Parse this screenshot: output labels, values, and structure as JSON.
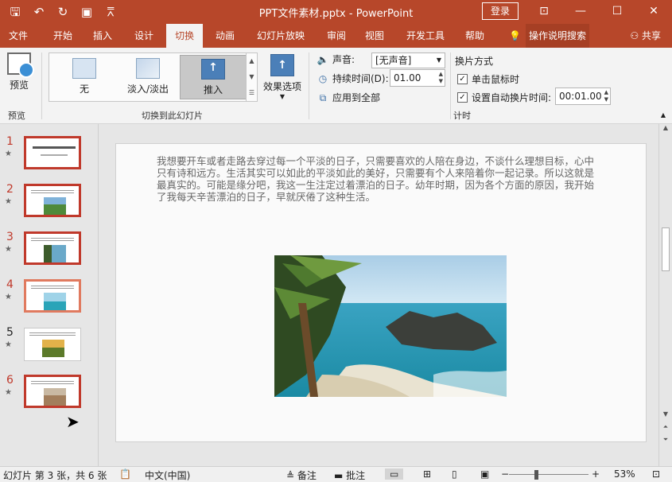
{
  "window": {
    "title": "PPT文件素材.pptx  -  PowerPoint",
    "login_label": "登录",
    "controls": [
      "ribbon-display-icon",
      "minimize-icon",
      "maximize-icon",
      "close-icon"
    ]
  },
  "qat": [
    "save-icon",
    "undo-icon",
    "redo-icon",
    "start-from-beginning-icon",
    "customize-icon"
  ],
  "tabs": [
    {
      "label": "文件"
    },
    {
      "label": "开始"
    },
    {
      "label": "插入"
    },
    {
      "label": "设计"
    },
    {
      "label": "切换",
      "active": true
    },
    {
      "label": "动画"
    },
    {
      "label": "幻灯片放映"
    },
    {
      "label": "审阅"
    },
    {
      "label": "视图"
    },
    {
      "label": "开发工具"
    },
    {
      "label": "帮助"
    }
  ],
  "tellme": {
    "text": "操作说明搜索"
  },
  "share": {
    "label": "共享"
  },
  "ribbon": {
    "preview": {
      "button": "预览",
      "group": "预览"
    },
    "transitions": {
      "items": [
        "无",
        "淡入/淡出",
        "推入"
      ],
      "selected": "推入",
      "effect_options": "效果选项",
      "group": "切换到此幻灯片"
    },
    "timing": {
      "sound_label": "声音:",
      "sound_value": "[无声音]",
      "duration_label": "持续时间(D):",
      "duration_value": "01.00",
      "apply_all": "应用到全部",
      "advance_title": "换片方式",
      "on_click_label": "单击鼠标时",
      "on_click_checked": true,
      "after_label": "设置自动换片时间:",
      "after_checked": true,
      "after_value": "00:01.00",
      "group": "计时"
    }
  },
  "slides": [
    {
      "number": "1",
      "star": "★"
    },
    {
      "number": "2",
      "star": "★"
    },
    {
      "number": "3",
      "star": "★",
      "selected": true
    },
    {
      "number": "4",
      "star": "★",
      "hover": true
    },
    {
      "number": "5",
      "star": "★"
    },
    {
      "number": "6",
      "star": "★"
    }
  ],
  "slide_content": {
    "paragraph": "我想要开车或者走路去穿过每一个平淡的日子，只需要喜欢的人陪在身边，不谈什么理想目标，心中只有诗和远方。生活其实可以如此的平淡如此的美好，只需要有个人来陪着你一起记录。所以这就是最真实的。可能是缘分吧，我这一生注定过着漂泊的日子。幼年时期，因为各个方面的原因，我开始了我每天辛苦漂泊的日子，早就厌倦了这种生活。"
  },
  "status": {
    "slide_info": "幻灯片 第 3 张，共 6 张",
    "language": "中文(中国)",
    "notes": "备注",
    "comments": "批注",
    "zoom": "53%"
  }
}
